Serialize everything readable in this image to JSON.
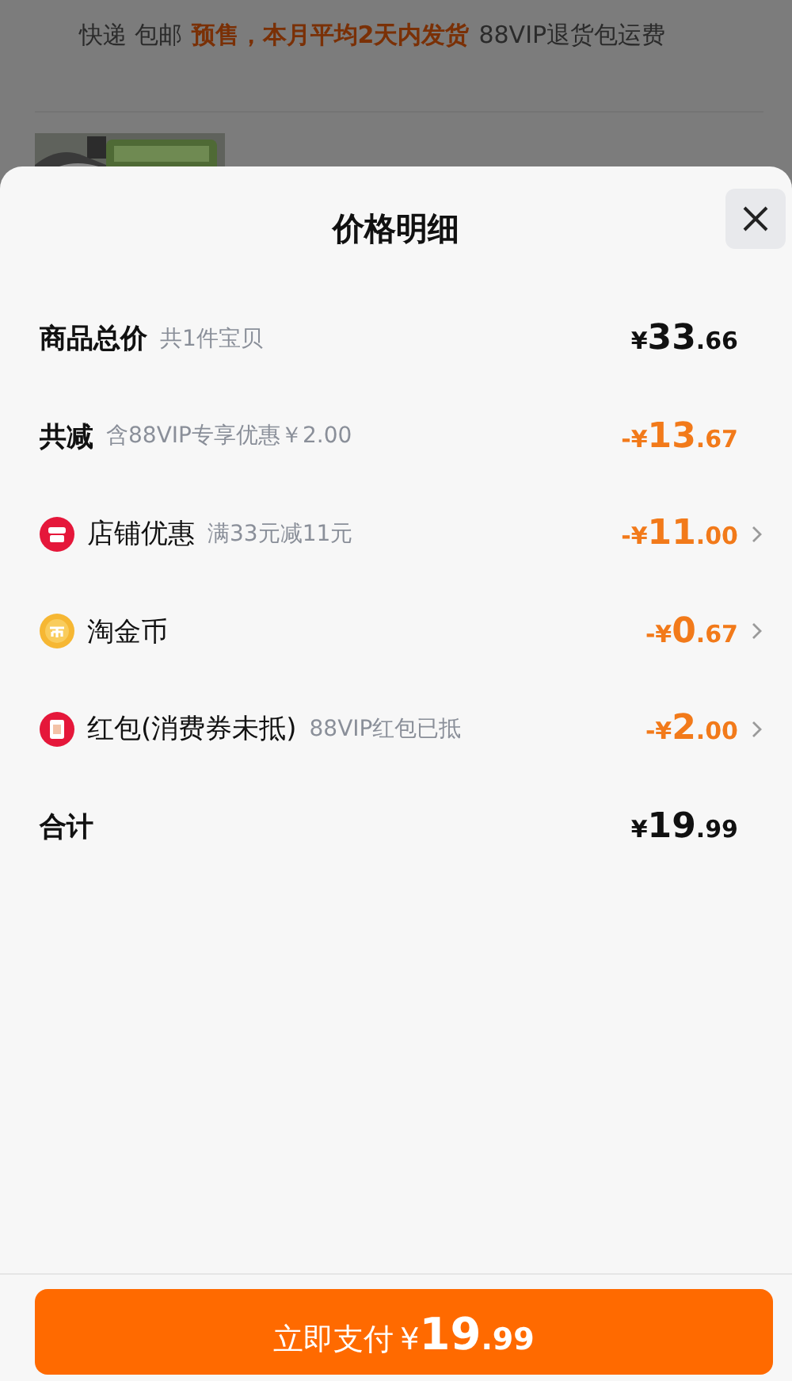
{
  "background_page": {
    "shipping_tags": [
      {
        "text": "快递 包邮",
        "kind": "plain"
      },
      {
        "text": "预售，本月平均2天内发货",
        "kind": "highlight"
      },
      {
        "text": "88VIP退货包运费",
        "kind": "plain"
      }
    ]
  },
  "sheet": {
    "title": "价格明细",
    "rows": [
      {
        "kind": "total",
        "label": "商品总价",
        "note": "共1件宝贝",
        "prefix": "¥",
        "int": "33",
        "dec": ".66"
      },
      {
        "kind": "reduction",
        "label": "共减",
        "note": "含88VIP专享优惠￥2.00",
        "prefix": "-¥",
        "int": "13",
        "dec": ".67"
      },
      {
        "kind": "store",
        "label": "店铺优惠",
        "note": "满33元减11元",
        "prefix": "-¥",
        "int": "11",
        "dec": ".00"
      },
      {
        "kind": "coin",
        "label": "淘金币",
        "prefix": "-¥",
        "int": "0",
        "dec": ".67"
      },
      {
        "kind": "red_packet",
        "label": "红包(消费券未抵)",
        "note": "88VIP红包已抵",
        "prefix": "-¥",
        "int": "2",
        "dec": ".00"
      },
      {
        "kind": "total",
        "label": "合计",
        "prefix": "¥",
        "int": "19",
        "dec": ".99"
      }
    ],
    "pay_button": {
      "label": "立即支付",
      "prefix": "¥",
      "int": "19",
      "dec": ".99"
    }
  }
}
